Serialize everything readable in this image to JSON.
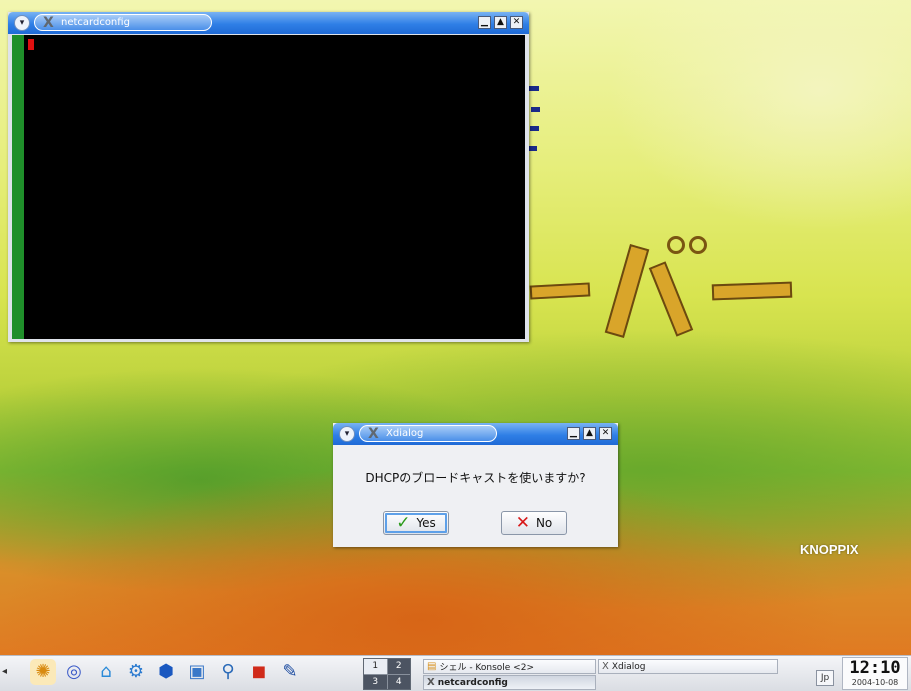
{
  "desktop": {
    "brand": "KNOPPIX"
  },
  "terminal_window": {
    "title": "netcardconfig",
    "menu_glyph": "▾",
    "minimize": "▁",
    "maximize": "▲",
    "close": "✕"
  },
  "dialog": {
    "title": "Xdialog",
    "question": "DHCPのブロードキャストを使いますか?",
    "yes_label": "Yes",
    "no_label": "No",
    "menu_glyph": "▾",
    "minimize": "▁",
    "maximize": "▲",
    "close": "✕"
  },
  "taskbar": {
    "pager": [
      "1",
      "2",
      "3",
      "4"
    ],
    "active_desktop": "1",
    "tasks": [
      {
        "label": "シェル - Konsole <2>",
        "icon": "konsole-icon",
        "active": false
      },
      {
        "label": "Xdialog",
        "icon": "x-icon",
        "active": false
      },
      {
        "label": "netcardconfig",
        "icon": "x-icon",
        "active": true
      }
    ],
    "keyboard_layout": "Jp",
    "clock_time": "12:10",
    "clock_date": "2004-10-08",
    "launchers": [
      "kde-menu-icon",
      "help-lifebuoy-icon",
      "home-folder-icon",
      "konqueror-icon",
      "office-icon",
      "control-center-icon",
      "search-icon",
      "presentation-icon",
      "editor-icon"
    ]
  },
  "colors": {
    "titlebar": "#2f7fe6",
    "terminal_bg": "#000000",
    "terminal_strip": "#1f8f2a"
  }
}
